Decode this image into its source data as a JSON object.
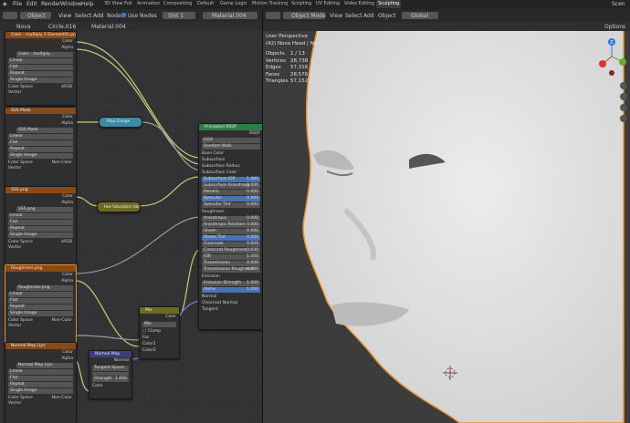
{
  "topbar": {
    "menus": [
      "File",
      "Edit",
      "Render",
      "Window",
      "Help"
    ],
    "tabs": [
      "3D View Full",
      "Animation",
      "Compositing",
      "Default",
      "Game Logic",
      "Motion Tracking",
      "Scripting",
      "UV Editing",
      "Video Editing",
      "Sculpting"
    ],
    "scene": "Scen"
  },
  "node_editor": {
    "header": {
      "mode": "Object",
      "menus": [
        "View",
        "Select",
        "Add",
        "Node"
      ],
      "use_nodes_label": "Use Nodes",
      "slot": "Slot 1",
      "material": "Material.004"
    },
    "breadcrumb": {
      "object": "Nova",
      "mesh": "Circle.016",
      "material": "Material.004"
    },
    "nodes": {
      "color_multiply": {
        "title": "Color - multiply 2 ElementOr.png",
        "out_color": "Color",
        "out_alpha": "Alpha",
        "image": "Color - multiply...",
        "interp": "Linear",
        "proj": "Flat",
        "ext": "Repeat",
        "source": "Single Image",
        "colorspace_label": "Color Space",
        "colorspace": "sRGB",
        "vector": "Vector"
      },
      "sss_mask": {
        "title": "SSS Mask",
        "out_color": "Color",
        "out_alpha": "Alpha",
        "image": "SSS Mask",
        "interp": "Linear",
        "proj": "Flat",
        "ext": "Repeat",
        "source": "Single Image",
        "colorspace_label": "Color Space",
        "colorspace": "Non-Color",
        "vector": "Vector"
      },
      "sss_png": {
        "title": "SSS.png",
        "out_color": "Color",
        "out_alpha": "Alpha",
        "image": "SSS.png",
        "interp": "Linear",
        "proj": "Flat",
        "ext": "Repeat",
        "source": "Single Image",
        "colorspace_label": "Color Space",
        "colorspace": "sRGB",
        "vector": "Vector"
      },
      "roughness": {
        "title": "Roughness.png",
        "out_color": "Color",
        "out_alpha": "Alpha",
        "image": "Roughness.png",
        "interp": "Linear",
        "proj": "Flat",
        "ext": "Repeat",
        "source": "Single Image",
        "colorspace_label": "Color Space",
        "colorspace": "Non-Color",
        "vector": "Vector"
      },
      "normal_map_img": {
        "title": "Normal Map Lips",
        "out_color": "Color",
        "out_alpha": "Alpha",
        "image": "Normal Map Lips",
        "interp": "Linear",
        "proj": "Flat",
        "ext": "Repeat",
        "source": "Single Image",
        "colorspace_label": "Color Space",
        "colorspace": "Non-Color",
        "vector": "Vector"
      },
      "map_range": {
        "title": "Map Range"
      },
      "hue_sat": {
        "title": "Hue Saturation Value"
      },
      "mix": {
        "title": "Mix",
        "out_color": "Color",
        "blend": "Mix",
        "clamp": "Clamp",
        "fac": "Fac",
        "color1": "Color1",
        "color2": "Color2"
      },
      "normal_map": {
        "title": "Normal Map",
        "out": "Normal",
        "space": "Tangent Space",
        "strength_label": "Strength",
        "strength": "1.000",
        "color": "Color"
      },
      "bsdf": {
        "title": "Principled BSDF",
        "out": "BSDF",
        "dist": "GGX",
        "sss_method": "Random Walk",
        "inputs": [
          {
            "label": "Base Color",
            "value": ""
          },
          {
            "label": "Subsurface",
            "value": ""
          },
          {
            "label": "Subsurface Radius",
            "value": ""
          },
          {
            "label": "Subsurface Color",
            "value": ""
          },
          {
            "label": "Subsurface IOR",
            "value": "1.400",
            "blue": true
          },
          {
            "label": "Subsurface Anisotropy",
            "value": "0.000"
          },
          {
            "label": "Metallic",
            "value": "0.000"
          },
          {
            "label": "Specular",
            "value": "0.500",
            "blue": true
          },
          {
            "label": "Specular Tint",
            "value": "0.000"
          },
          {
            "label": "Roughness",
            "value": ""
          },
          {
            "label": "Anisotropic",
            "value": "0.000"
          },
          {
            "label": "Anisotropic Rotation",
            "value": "0.000"
          },
          {
            "label": "Sheen",
            "value": "0.000"
          },
          {
            "label": "Sheen Tint",
            "value": "0.500",
            "blue": true
          },
          {
            "label": "Clearcoat",
            "value": "0.000"
          },
          {
            "label": "Clearcoat Roughness",
            "value": "0.030"
          },
          {
            "label": "IOR",
            "value": "1.450"
          },
          {
            "label": "Transmission",
            "value": "0.000"
          },
          {
            "label": "Transmission Roughness",
            "value": "0.000"
          },
          {
            "label": "Emission",
            "value": ""
          },
          {
            "label": "Emission Strength",
            "value": "1.000"
          },
          {
            "label": "Alpha",
            "value": "1.000",
            "blue": true
          },
          {
            "label": "Normal",
            "value": ""
          },
          {
            "label": "Clearcoat Normal",
            "value": ""
          },
          {
            "label": "Tangent",
            "value": ""
          }
        ]
      }
    }
  },
  "viewport": {
    "header": {
      "mode": "Object Mode",
      "menus": [
        "View",
        "Select",
        "Add",
        "Object"
      ],
      "orientation": "Global"
    },
    "options": "Options",
    "overlay": {
      "title": "User Perspective",
      "subtitle": "(42) Nova Head | Nova"
    },
    "stats": [
      {
        "label": "Objects",
        "value": "1 / 13"
      },
      {
        "label": "Vertices",
        "value": "28,738"
      },
      {
        "label": "Edges",
        "value": "57,316"
      },
      {
        "label": "Faces",
        "value": "28,576"
      },
      {
        "label": "Triangles",
        "value": "57,152"
      }
    ],
    "gizmo": {
      "z": "Z",
      "x": "X",
      "y": "Y"
    }
  },
  "colors": {
    "image_node": "#8a4a17",
    "converter_node": "#3f88a8",
    "color_node": "#6c6c1e",
    "vector_node": "#3b3f7a",
    "shader_node": "#2e7d46",
    "wire": "#c9c97a",
    "wire_gray": "#9a9a9a",
    "selected_outline": "#e0902a"
  }
}
